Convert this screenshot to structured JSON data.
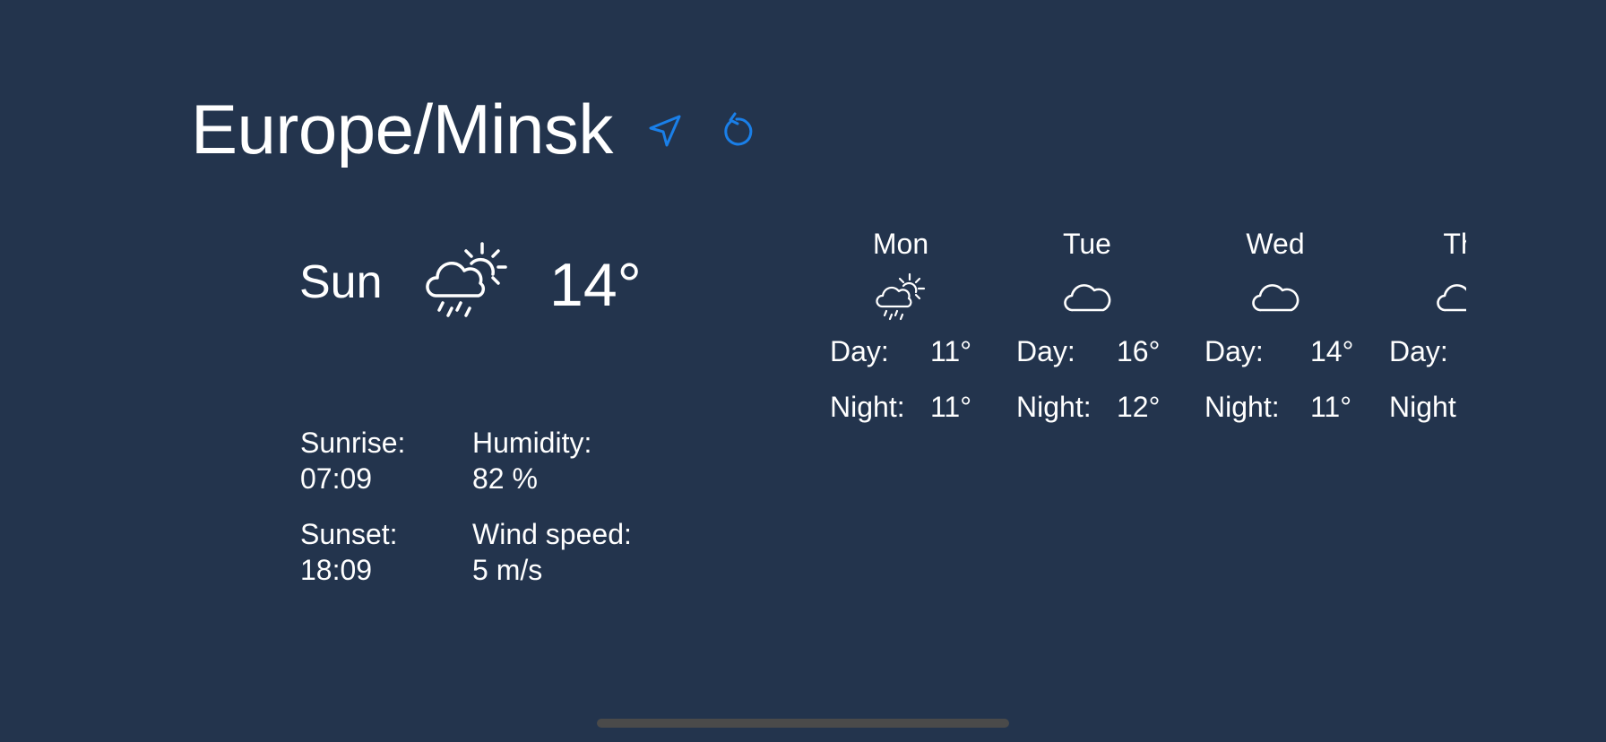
{
  "header": {
    "title": "Europe/Minsk",
    "location_icon": "location-arrow-icon",
    "refresh_icon": "refresh-icon",
    "accent_color": "#1a7fe8"
  },
  "today": {
    "day": "Sun",
    "icon": "partly-cloudy-rain-icon",
    "temperature": "14°",
    "sunrise_label": "Sunrise:",
    "sunrise_value": "07:09",
    "sunset_label": "Sunset:",
    "sunset_value": "18:09",
    "humidity_label": "Humidity:",
    "humidity_value": "82 %",
    "wind_label": "Wind speed:",
    "wind_value": "5 m/s"
  },
  "forecast": [
    {
      "day": "Mon",
      "icon": "partly-cloudy-rain-icon",
      "day_label": "Day:",
      "day_temp": "11°",
      "night_label": "Night:",
      "night_temp": "11°"
    },
    {
      "day": "Tue",
      "icon": "cloud-icon",
      "day_label": "Day:",
      "day_temp": "16°",
      "night_label": "Night:",
      "night_temp": "12°"
    },
    {
      "day": "Wed",
      "icon": "cloud-icon",
      "day_label": "Day:",
      "day_temp": "14°",
      "night_label": "Night:",
      "night_temp": "11°"
    },
    {
      "day": "Th",
      "icon": "cloud-icon",
      "day_label": "Day:",
      "day_temp": "",
      "night_label": "Night",
      "night_temp": ""
    }
  ]
}
